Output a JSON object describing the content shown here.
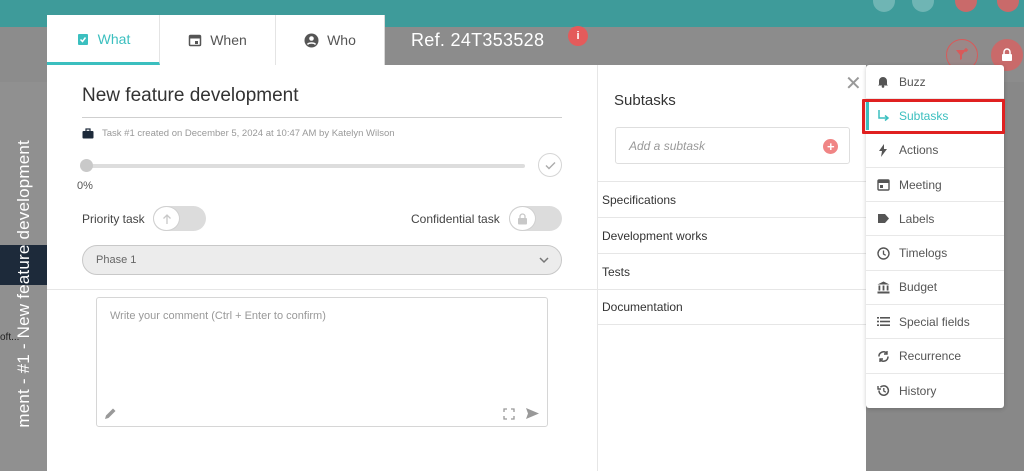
{
  "colors": {
    "accent": "#3bbfbf",
    "topbar": "#3e9b9a",
    "highlight": "#e02020",
    "badge": "#e45b5b"
  },
  "background": {
    "vertical_title": "ment - #1 - New feature development",
    "soft_text": "oft..."
  },
  "tabs": [
    {
      "label": "What",
      "icon": "clipboard-check-icon",
      "active": true
    },
    {
      "label": "When",
      "icon": "calendar-icon",
      "active": false
    },
    {
      "label": "Who",
      "icon": "user-circle-icon",
      "active": false
    }
  ],
  "ref_title": "Ref. 24T353528",
  "info_badge": "i",
  "task": {
    "title": "New feature development",
    "meta": "Task #1 created on December 5, 2024 at 10:47 AM by Katelyn Wilson",
    "progress": 0,
    "progress_label": "0%",
    "priority_label": "Priority task",
    "confidential_label": "Confidential task",
    "phase": "Phase 1",
    "comment_placeholder": "Write your comment (Ctrl + Enter to confirm)"
  },
  "subtasks": {
    "heading": "Subtasks",
    "add_placeholder": "Add a subtask",
    "items": [
      "Specifications",
      "Development works",
      "Tests",
      "Documentation"
    ]
  },
  "menu": [
    {
      "label": "Buzz",
      "icon": "bell-icon"
    },
    {
      "label": "Subtasks",
      "icon": "subtask-arrow-icon",
      "active": true
    },
    {
      "label": "Actions",
      "icon": "lightning-icon"
    },
    {
      "label": "Meeting",
      "icon": "calendar-icon"
    },
    {
      "label": "Labels",
      "icon": "tag-icon"
    },
    {
      "label": "Timelogs",
      "icon": "clock-icon"
    },
    {
      "label": "Budget",
      "icon": "bank-icon"
    },
    {
      "label": "Special fields",
      "icon": "list-icon"
    },
    {
      "label": "Recurrence",
      "icon": "refresh-icon"
    },
    {
      "label": "History",
      "icon": "history-icon"
    }
  ]
}
